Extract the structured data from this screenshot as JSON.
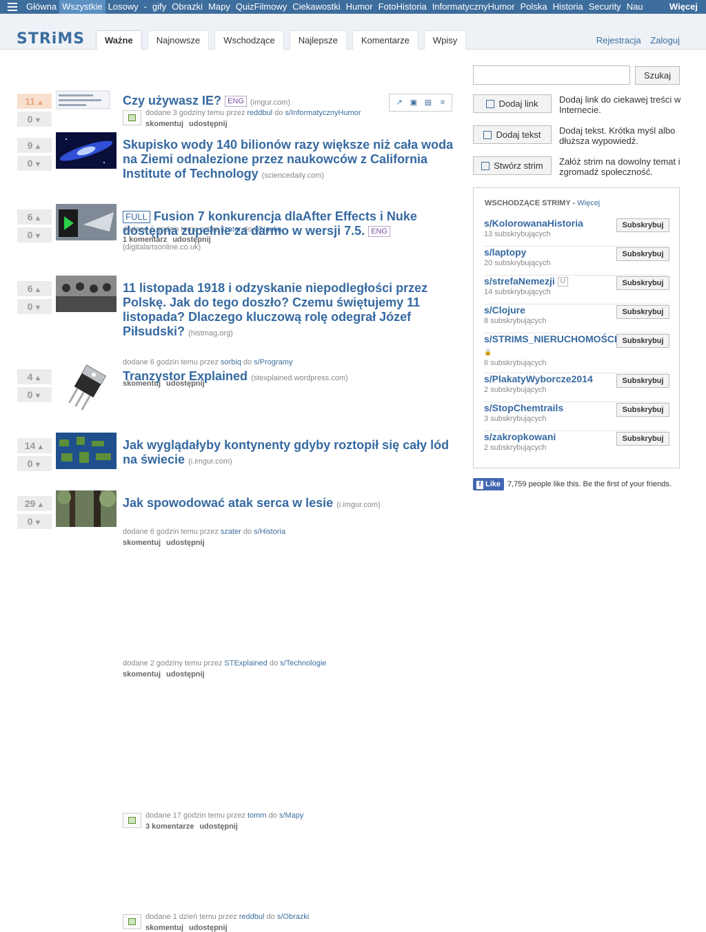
{
  "topnav": {
    "items": [
      "Główna",
      "Wszystkie",
      "Losowy",
      "-",
      "gify",
      "Obrazki",
      "Mapy",
      "QuizFilmowy",
      "Ciekawostki",
      "Humor",
      "FotoHistoria",
      "InformatycznyHumor",
      "Polska",
      "Historia",
      "Security",
      "Nau"
    ],
    "active_index": 1,
    "more": "Więcej"
  },
  "header": {
    "logo": "STRiMS",
    "tabs": [
      "Ważne",
      "Najnowsze",
      "Wschodzące",
      "Najlepsze",
      "Komentarze",
      "Wpisy"
    ],
    "active_tab": 0,
    "register": "Rejestracja",
    "login": "Zaloguj"
  },
  "posts": [
    {
      "up": "11",
      "down": "0",
      "tag_before": "",
      "title": "Czy używasz IE?",
      "tag_after": "ENG",
      "domain": "(imgur.com)",
      "meta_pre": "dodane 3 godziny temu przez",
      "user": "reddbul",
      "meta_mid": "do",
      "strim": "s/InformatycznyHumor",
      "comments": "skomentuj",
      "share": "udostępnij",
      "hot": true
    },
    {
      "up": "9",
      "down": "0",
      "tag_before": "",
      "title": "Skupisko wody 140 bilionów razy większe niż cała woda na Ziemi odnalezione przez naukowców z California Institute of Technology",
      "tag_after": "",
      "domain": "(sciencedaily.com)",
      "meta_pre": "dodane 6 godzin temu przez",
      "user": "szater",
      "meta_mid": "do",
      "strim": "s/Nauka",
      "comments": "1 komentarz",
      "share": "udostępnij",
      "hot": false
    },
    {
      "up": "6",
      "down": "0",
      "tag_before": "FULL",
      "title": "Fusion 7 konkurencja dlaAfter Effects i Nuke dostępna zupełnie za darmo w wersji 7.5.",
      "tag_after": "ENG",
      "domain": "(digitalartsonline.co.uk)",
      "meta_pre": "dodane 6 godzin temu przez",
      "user": "sorbiq",
      "meta_mid": "do",
      "strim": "s/Programy",
      "comments": "skomentuj",
      "share": "udostępnij",
      "hot": false
    },
    {
      "up": "6",
      "down": "0",
      "tag_before": "",
      "title": "11 listopada 1918 i odzyskanie niepodległości przez Polskę. Jak do tego doszło? Czemu świętujemy 11 listopada? Dlaczego kluczową rolę odegrał Józef Piłsudski?",
      "tag_after": "",
      "domain": "(histmag.org)",
      "meta_pre": "dodane 6 godzin temu przez",
      "user": "szater",
      "meta_mid": "do",
      "strim": "s/Historia",
      "comments": "skomentuj",
      "share": "udostępnij",
      "hot": false
    },
    {
      "up": "4",
      "down": "0",
      "tag_before": "",
      "title": "Tranzystor Explained",
      "tag_after": "",
      "domain": "(stexplained.wordpress.com)",
      "meta_pre": "dodane 2 godziny temu przez",
      "user": "STExplained",
      "meta_mid": "do",
      "strim": "s/Technologie",
      "comments": "skomentuj",
      "share": "udostępnij",
      "hot": false
    },
    {
      "up": "14",
      "down": "0",
      "tag_before": "",
      "title": "Jak wyglądałyby kontynenty gdyby roztopił się cały lód na świecie",
      "tag_after": "",
      "domain": "(i.imgur.com)",
      "meta_pre": "dodane 17 godzin temu przez",
      "user": "tomm",
      "meta_mid": "do",
      "strim": "s/Mapy",
      "comments": "3 komentarze",
      "share": "udostępnij",
      "hot": false
    },
    {
      "up": "29",
      "down": "0",
      "tag_before": "",
      "title": "Jak spowodować atak serca w lesie",
      "tag_after": "",
      "domain": "(i.imgur.com)",
      "meta_pre": "dodane 1 dzień temu przez",
      "user": "reddbul",
      "meta_mid": "do",
      "strim": "s/Obrazki",
      "comments": "skomentuj",
      "share": "udostępnij",
      "hot": false
    }
  ],
  "sidebar": {
    "search_button": "Szukaj",
    "search_value": "",
    "actions": [
      {
        "label": "Dodaj link",
        "desc": "Dodaj link do ciekawej treści w Internecie."
      },
      {
        "label": "Dodaj tekst",
        "desc": "Dodaj tekst. Krótka myśl albo dłuższa wypowiedź."
      },
      {
        "label": "Stwórz strim",
        "desc": "Załóż strim na dowolny temat i zgromadź społeczność."
      }
    ],
    "strims_title": "WSCHODZĄCE STRIMY",
    "strims_more": "Więcej",
    "subscribe_label": "Subskrybuj",
    "strims": [
      {
        "name": "s/KolorowanaHistoria",
        "count": "13 subskrybujących",
        "badge": ""
      },
      {
        "name": "s/laptopy",
        "count": "20 subskrybujących",
        "badge": ""
      },
      {
        "name": "s/strefaNemezji",
        "count": "14 subskrybujących",
        "badge": "U"
      },
      {
        "name": "s/Clojure",
        "count": "8 subskrybujących",
        "badge": ""
      },
      {
        "name": "s/STRIMS_NIERUCHOMOŚCI",
        "count": "6 subskrybujących",
        "badge": "lock"
      },
      {
        "name": "s/PlakatyWyborcze2014",
        "count": "2 subskrybujących",
        "badge": ""
      },
      {
        "name": "s/StopChemtrails",
        "count": "3 subskrybujących",
        "badge": ""
      },
      {
        "name": "s/zakropkowani",
        "count": "2 subskrybujących",
        "badge": ""
      }
    ],
    "fb_like": "Like",
    "fb_text": "7,759 people like this. Be the first of your friends."
  }
}
